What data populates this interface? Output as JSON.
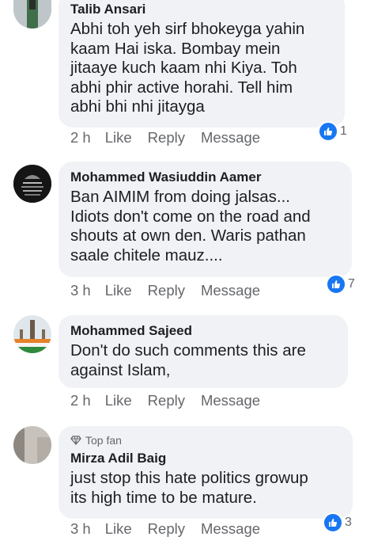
{
  "actions": {
    "like": "Like",
    "reply": "Reply",
    "message": "Message"
  },
  "comments": [
    {
      "author": "Talib Ansari",
      "time": "2 h",
      "lines": [
        "Abhi toh yeh sirf bhokeyga yahin",
        "kaam Hai iska. Bombay mein",
        "jitaaye kuch kaam nhi Kiya. Toh",
        "abhi phir active horahi. Tell him",
        "abhi bhi nhi jitayga"
      ],
      "reactions": "1"
    },
    {
      "author": "Mohammed Wasiuddin Aamer",
      "time": "3 h",
      "lines": [
        "Ban AIMIM from doing jalsas...",
        "Idiots don't come on the road and",
        "shouts at own den. Waris pathan",
        "saale chitele mauz...."
      ],
      "reactions": "7"
    },
    {
      "author": "Mohammed Sajeed",
      "time": "2 h",
      "lines": [
        "Don't do such comments this are",
        "against Islam,"
      ],
      "reactions": ""
    },
    {
      "author": "Mirza Adil Baig",
      "badge": "Top fan",
      "time": "3 h",
      "lines": [
        "just stop this hate politics growup",
        "its high time to be mature."
      ],
      "reactions": "3"
    }
  ],
  "colors": {
    "bubble": "#f0f2f5",
    "like_blue": "#1877f2",
    "meta_gray": "#65676b"
  }
}
